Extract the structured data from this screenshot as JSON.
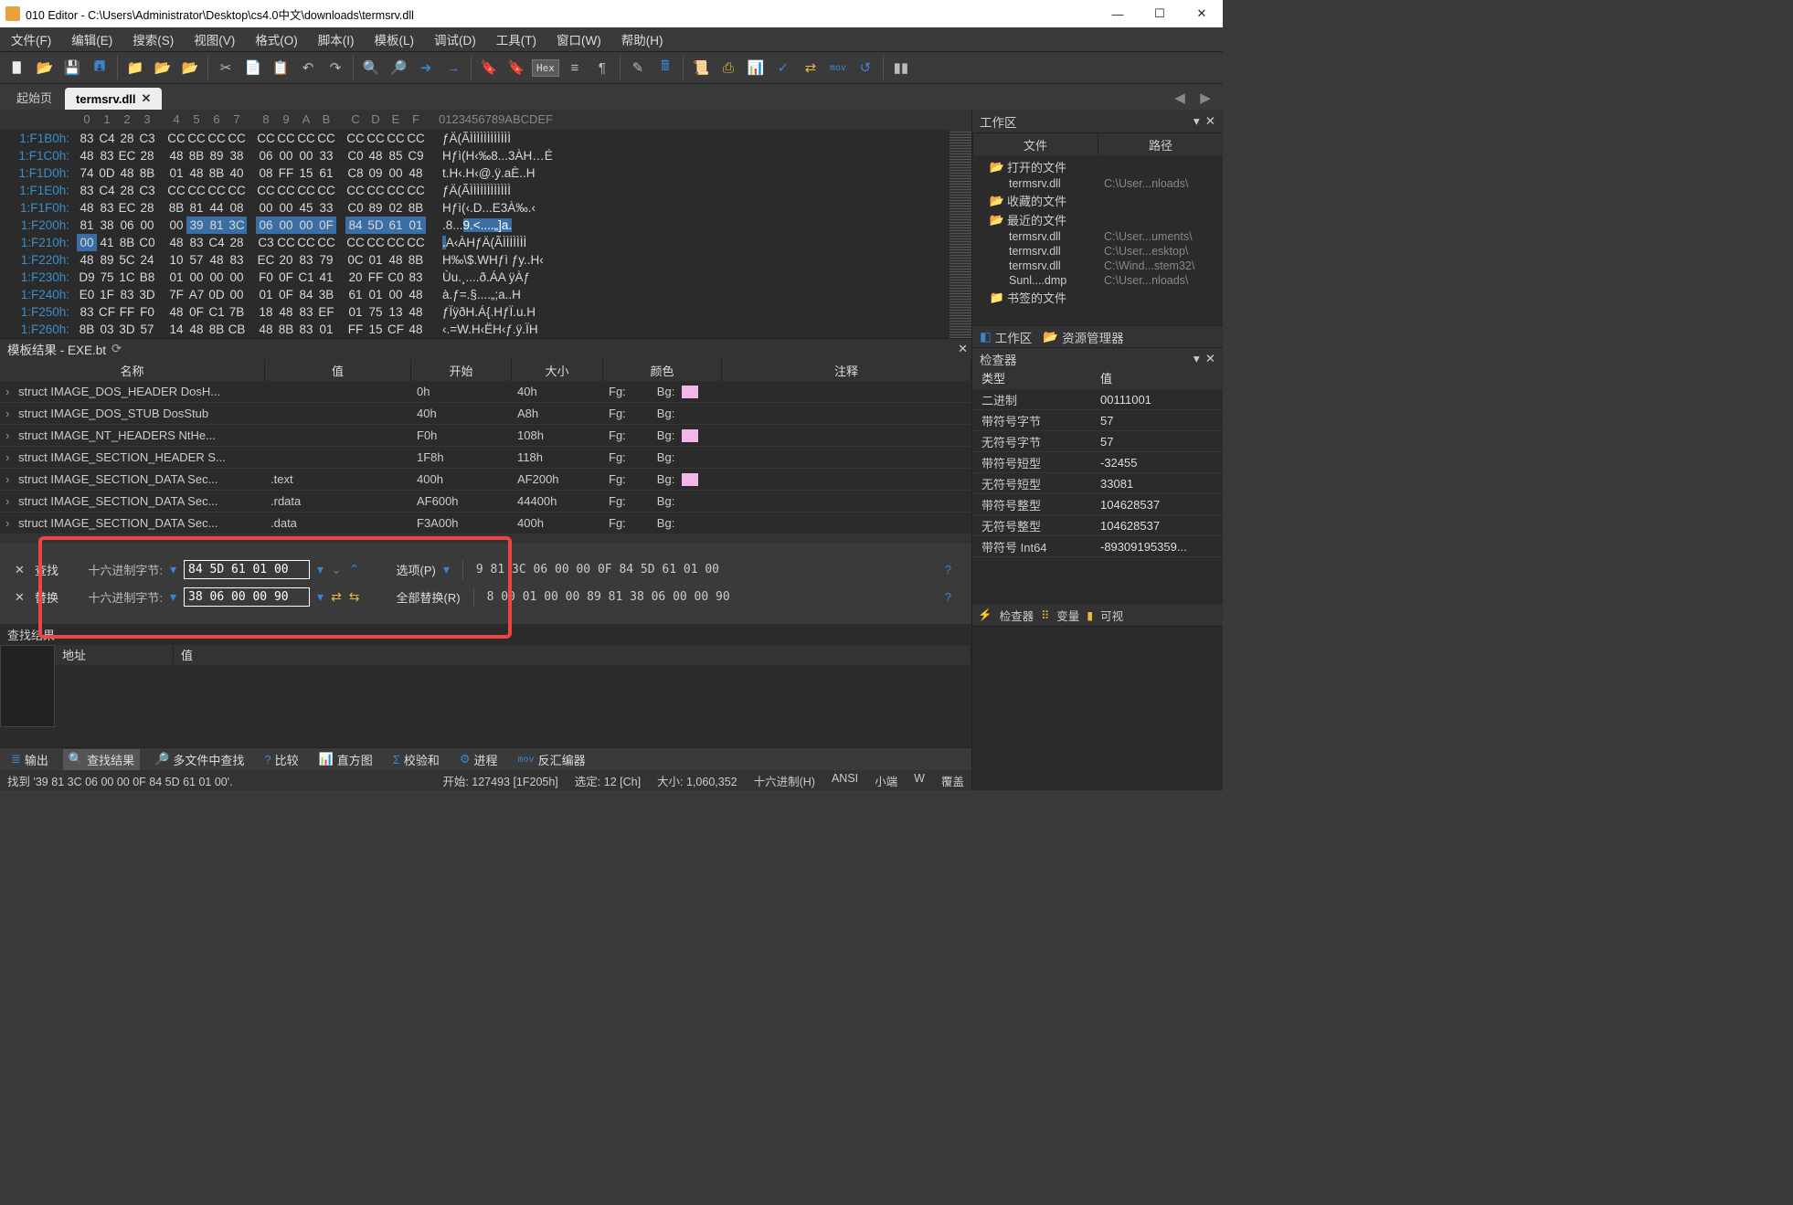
{
  "title": "010 Editor - C:\\Users\\Administrator\\Desktop\\cs4.0中文\\downloads\\termsrv.dll",
  "menu": [
    "文件(F)",
    "编辑(E)",
    "搜索(S)",
    "视图(V)",
    "格式(O)",
    "脚本(I)",
    "模板(L)",
    "调试(D)",
    "工具(T)",
    "窗口(W)",
    "帮助(H)"
  ],
  "tabs": {
    "start": "起始页",
    "active": "termsrv.dll"
  },
  "hex_header": {
    "cols": [
      "0",
      "1",
      "2",
      "3",
      "4",
      "5",
      "6",
      "7",
      "8",
      "9",
      "A",
      "B",
      "C",
      "D",
      "E",
      "F"
    ],
    "ascii": "0123456789ABCDEF"
  },
  "hex_rows": [
    {
      "off": "1:F1B0h:",
      "b": [
        "83",
        "C4",
        "28",
        "C3",
        "CC",
        "CC",
        "CC",
        "CC",
        "CC",
        "CC",
        "CC",
        "CC",
        "CC",
        "CC",
        "CC",
        "CC"
      ],
      "a": "ƒÄ(ÃÌÌÌÌÌÌÌÌÌÌÌÌ"
    },
    {
      "off": "1:F1C0h:",
      "b": [
        "48",
        "83",
        "EC",
        "28",
        "48",
        "8B",
        "89",
        "38",
        "06",
        "00",
        "00",
        "33",
        "C0",
        "48",
        "85",
        "C9"
      ],
      "a": "Hƒì(H‹‰8...3ÀH…É"
    },
    {
      "off": "1:F1D0h:",
      "b": [
        "74",
        "0D",
        "48",
        "8B",
        "01",
        "48",
        "8B",
        "40",
        "08",
        "FF",
        "15",
        "61",
        "C8",
        "09",
        "00",
        "48"
      ],
      "a": "t.H‹.H‹@.ÿ.aÈ..H"
    },
    {
      "off": "1:F1E0h:",
      "b": [
        "83",
        "C4",
        "28",
        "C3",
        "CC",
        "CC",
        "CC",
        "CC",
        "CC",
        "CC",
        "CC",
        "CC",
        "CC",
        "CC",
        "CC",
        "CC"
      ],
      "a": "ƒÄ(ÃÌÌÌÌÌÌÌÌÌÌÌÌ"
    },
    {
      "off": "1:F1F0h:",
      "b": [
        "48",
        "83",
        "EC",
        "28",
        "8B",
        "81",
        "44",
        "08",
        "00",
        "00",
        "45",
        "33",
        "C0",
        "89",
        "02",
        "8B"
      ],
      "a": "Hƒì(‹.D...E3À‰.‹"
    },
    {
      "off": "1:F200h:",
      "b": [
        "81",
        "38",
        "06",
        "00",
        "00",
        "39",
        "81",
        "3C",
        "06",
        "00",
        "00",
        "0F",
        "84",
        "5D",
        "61",
        "01"
      ],
      "a": ".8...9.<....„]a.",
      "sel": [
        5,
        16
      ]
    },
    {
      "off": "1:F210h:",
      "b": [
        "00",
        "41",
        "8B",
        "C0",
        "48",
        "83",
        "C4",
        "28",
        "C3",
        "CC",
        "CC",
        "CC",
        "CC",
        "CC",
        "CC",
        "CC"
      ],
      "a": ".A‹ÀHƒÄ(ÃÌÌÌÌÌÌÌ",
      "sel": [
        0,
        1
      ]
    },
    {
      "off": "1:F220h:",
      "b": [
        "48",
        "89",
        "5C",
        "24",
        "10",
        "57",
        "48",
        "83",
        "EC",
        "20",
        "83",
        "79",
        "0C",
        "01",
        "48",
        "8B"
      ],
      "a": "H‰\\$.WHƒì ƒy..H‹"
    },
    {
      "off": "1:F230h:",
      "b": [
        "D9",
        "75",
        "1C",
        "B8",
        "01",
        "00",
        "00",
        "00",
        "F0",
        "0F",
        "C1",
        "41",
        "20",
        "FF",
        "C0",
        "83"
      ],
      "a": "Ùu.¸....ð.ÁA ÿÀƒ"
    },
    {
      "off": "1:F240h:",
      "b": [
        "E0",
        "1F",
        "83",
        "3D",
        "7F",
        "A7",
        "0D",
        "00",
        "01",
        "0F",
        "84",
        "3B",
        "61",
        "01",
        "00",
        "48"
      ],
      "a": "à.ƒ=.§....„;a..H"
    },
    {
      "off": "1:F250h:",
      "b": [
        "83",
        "CF",
        "FF",
        "F0",
        "48",
        "0F",
        "C1",
        "7B",
        "18",
        "48",
        "83",
        "EF",
        "01",
        "75",
        "13",
        "48"
      ],
      "a": "ƒÏÿðH.Á{.HƒÏ.u.H"
    },
    {
      "off": "1:F260h:",
      "b": [
        "8B",
        "03",
        "3D",
        "57",
        "14",
        "48",
        "8B",
        "CB",
        "48",
        "8B",
        "83",
        "01",
        "FF",
        "15",
        "CF",
        "48"
      ],
      "a": "‹.=W.H‹ËH‹ƒ.ÿ.ÏH"
    }
  ],
  "tpl": {
    "title": "模板结果 - EXE.bt",
    "cols": {
      "name": "名称",
      "val": "值",
      "start": "开始",
      "size": "大小",
      "color": "颜色",
      "comm": "注释"
    },
    "rows": [
      {
        "name": "struct IMAGE_DOS_HEADER DosH...",
        "val": "",
        "start": "0h",
        "size": "40h",
        "fg": "Fg:",
        "bg": "Bg:",
        "sw": true
      },
      {
        "name": "struct IMAGE_DOS_STUB DosStub",
        "val": "",
        "start": "40h",
        "size": "A8h",
        "fg": "Fg:",
        "bg": "Bg:",
        "sw": false
      },
      {
        "name": "struct IMAGE_NT_HEADERS NtHe...",
        "val": "",
        "start": "F0h",
        "size": "108h",
        "fg": "Fg:",
        "bg": "Bg:",
        "sw": true
      },
      {
        "name": "struct IMAGE_SECTION_HEADER S...",
        "val": "",
        "start": "1F8h",
        "size": "118h",
        "fg": "Fg:",
        "bg": "Bg:",
        "sw": false
      },
      {
        "name": "struct IMAGE_SECTION_DATA Sec...",
        "val": ".text",
        "start": "400h",
        "size": "AF200h",
        "fg": "Fg:",
        "bg": "Bg:",
        "sw": true
      },
      {
        "name": "struct IMAGE_SECTION_DATA Sec...",
        "val": ".rdata",
        "start": "AF600h",
        "size": "44400h",
        "fg": "Fg:",
        "bg": "Bg:",
        "sw": false
      },
      {
        "name": "struct IMAGE_SECTION_DATA Sec...",
        "val": ".data",
        "start": "F3A00h",
        "size": "400h",
        "fg": "Fg:",
        "bg": "Bg:",
        "sw": false
      }
    ]
  },
  "search": {
    "find_lab": "查找",
    "replace_lab": "替换",
    "type": "十六进制字节:",
    "find_val": "84 5D 61 01 00",
    "replace_val": "38 06 00 00 90",
    "options": "选项(P)",
    "replace_all": "全部替换(R)",
    "shown1": "9 81 3C 06 00 00 0F 84 5D 61 01 00",
    "shown2": "8 00 01 00 00 89 81 38 06 00 00 90"
  },
  "findres": {
    "title": "查找结果",
    "addr": "地址",
    "val": "值"
  },
  "bottomtabs": [
    "输出",
    "查找结果",
    "多文件中查找",
    "比较",
    "直方图",
    "校验和",
    "进程",
    "反汇编器"
  ],
  "status": {
    "left": "找到 '39 81 3C 06 00 00 0F 84 5D 61 01 00'.",
    "right": [
      "开始: 127493 [1F205h]",
      "选定: 12 [Ch]",
      "大小: 1,060,352",
      "十六进制(H)",
      "ANSI",
      "小端",
      "W",
      "覆盖"
    ]
  },
  "workspace": {
    "title": "工作区",
    "headers": {
      "file": "文件",
      "path": "路径"
    },
    "open": "打开的文件",
    "fav": "收藏的文件",
    "recent": "最近的文件",
    "book": "书签的文件",
    "open_files": [
      {
        "n": "termsrv.dll",
        "p": "C:\\User...nloads\\"
      }
    ],
    "recent_files": [
      {
        "n": "termsrv.dll",
        "p": "C:\\User...uments\\"
      },
      {
        "n": "termsrv.dll",
        "p": "C:\\User...esktop\\"
      },
      {
        "n": "termsrv.dll",
        "p": "C:\\Wind...stem32\\"
      },
      {
        "n": "Sunl....dmp",
        "p": "C:\\User...nloads\\"
      }
    ]
  },
  "inspector": {
    "tab1": "工作区",
    "tab2": "资源管理器",
    "title": "检查器",
    "cols": {
      "k": "类型",
      "v": "值"
    },
    "rows": [
      {
        "k": "二进制",
        "v": "00111001"
      },
      {
        "k": "带符号字节",
        "v": "57"
      },
      {
        "k": "无符号字节",
        "v": "57"
      },
      {
        "k": "带符号短型",
        "v": "-32455"
      },
      {
        "k": "无符号短型",
        "v": "33081"
      },
      {
        "k": "带符号整型",
        "v": "104628537"
      },
      {
        "k": "无符号整型",
        "v": "104628537"
      },
      {
        "k": "带符号 Int64",
        "v": "-89309195359..."
      }
    ],
    "btabs": [
      "检查器",
      "变量",
      "可视"
    ]
  }
}
